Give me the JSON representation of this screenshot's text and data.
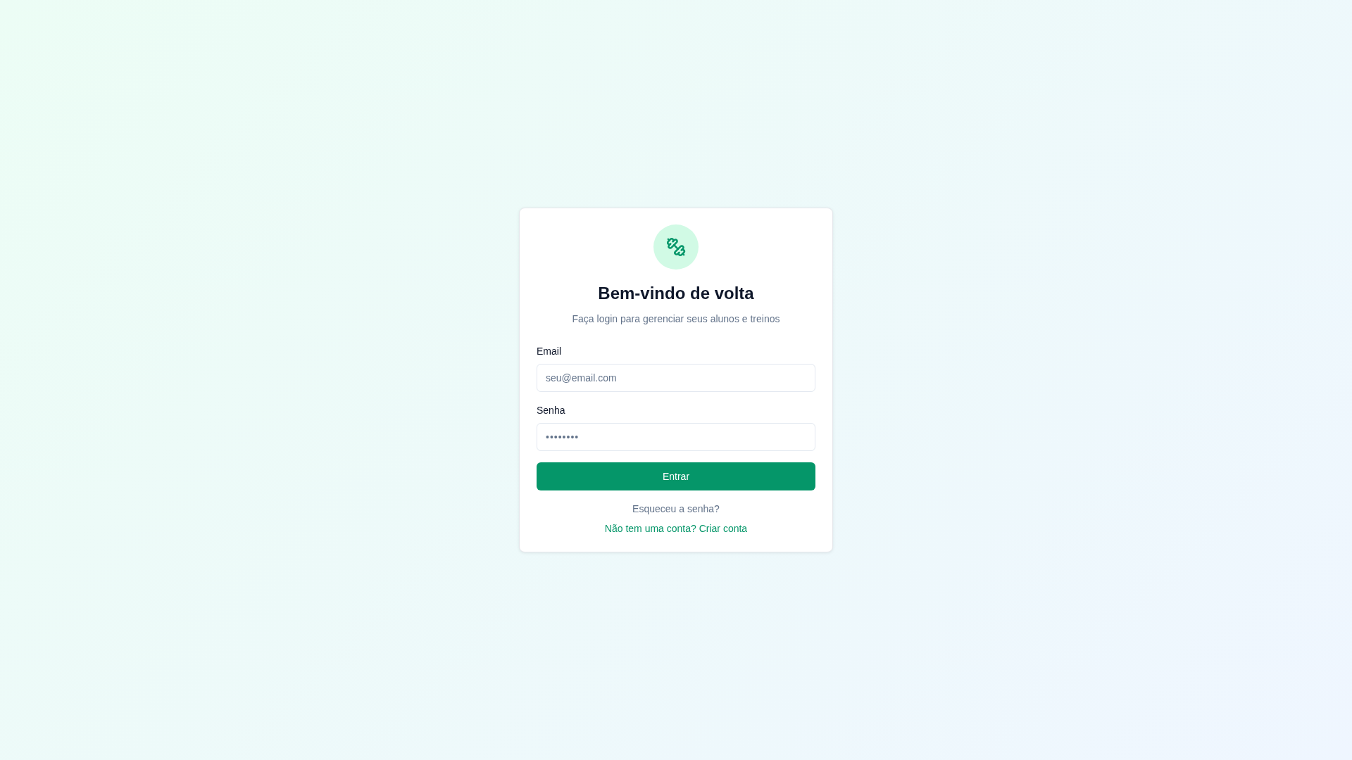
{
  "card": {
    "title": "Bem-vindo de volta",
    "subtitle": "Faça login para gerenciar seus alunos e treinos"
  },
  "fields": [
    {
      "label": "Email",
      "placeholder": "seu@email.com"
    },
    {
      "label": "Senha",
      "value": "••••••••"
    }
  ],
  "submit_button": "Entrar",
  "forgot_link": "Esqueceu a senha?",
  "signup_link": "Não tem uma conta? Criar conta"
}
